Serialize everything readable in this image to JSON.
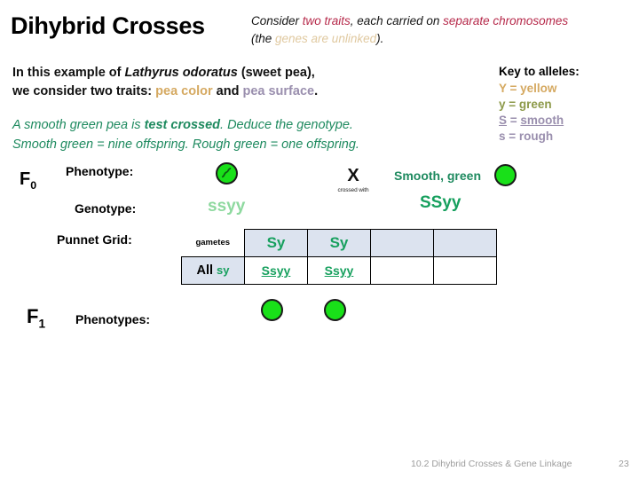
{
  "slide": {
    "title": "Dihybrid Crosses",
    "intro": {
      "part1": "Consider ",
      "highlight1": "two traits",
      "part2": ", each carried on ",
      "highlight2": "separate chromosomes",
      "part3": " (the ",
      "muted": "genes are unlinked",
      "part4": ")."
    },
    "body": {
      "line1_a": "In this example of ",
      "line1_species": "Lathyrus odoratus",
      "line1_b": " (sweet pea),",
      "line2_a": "we consider two traits: ",
      "line2_trait1": "pea color",
      "line2_b": " and ",
      "line2_trait2": "pea surface",
      "line2_c": "."
    },
    "green_para": {
      "line1_a": "A smooth green pea is ",
      "line1_bold": "test crossed",
      "line1_b": ". Deduce the genotype.",
      "line2": "Smooth green = nine offspring.  Rough green = one offspring."
    },
    "key": {
      "title": "Key to alleles:",
      "rows": [
        {
          "allele": "Y",
          "equals": " = ",
          "trait": "yellow"
        },
        {
          "allele": "y",
          "equals": " = ",
          "trait": "green"
        },
        {
          "allele": "S",
          "equals": " = ",
          "trait": "smooth"
        },
        {
          "allele": "s",
          "equals": " = ",
          "trait": "rough"
        }
      ]
    },
    "generations": {
      "f0": "F",
      "f0_sub": "0",
      "f1": "F",
      "f1_sub": "1"
    },
    "row_labels": {
      "phenotype": "Phenotype:",
      "genotype": "Genotype:",
      "punnet_grid": "Punnet Grid:",
      "phenotypes": "Phenotypes:"
    },
    "cross": {
      "symbol": "X",
      "caption": "crossed with"
    },
    "parents": {
      "left_genotype": "ssyy",
      "right_label": "Smooth, green",
      "right_genotype": "SSyy"
    },
    "punnett": {
      "corner_label": "gametes",
      "column_headers": [
        "Sy",
        "Sy",
        "",
        ""
      ],
      "row_header_prefix": "All ",
      "row_header_allele": "sy",
      "cells": [
        "Ssyy",
        "Ssyy",
        "",
        ""
      ]
    },
    "footer": {
      "text": "10.2 Dihybrid Crosses & Gene Linkage",
      "page": "23"
    },
    "colors": {
      "crimson": "#b6294a",
      "tan": "#e0c9a0",
      "pea_color": "#d5a961",
      "pea_surface": "#9a8fae",
      "green": "#1e8a5f",
      "genotype_green": "#17a05e",
      "pea_fill": "#19e019",
      "grid_header": "#dce3ef",
      "footer_gray": "#9c9c9c"
    }
  }
}
